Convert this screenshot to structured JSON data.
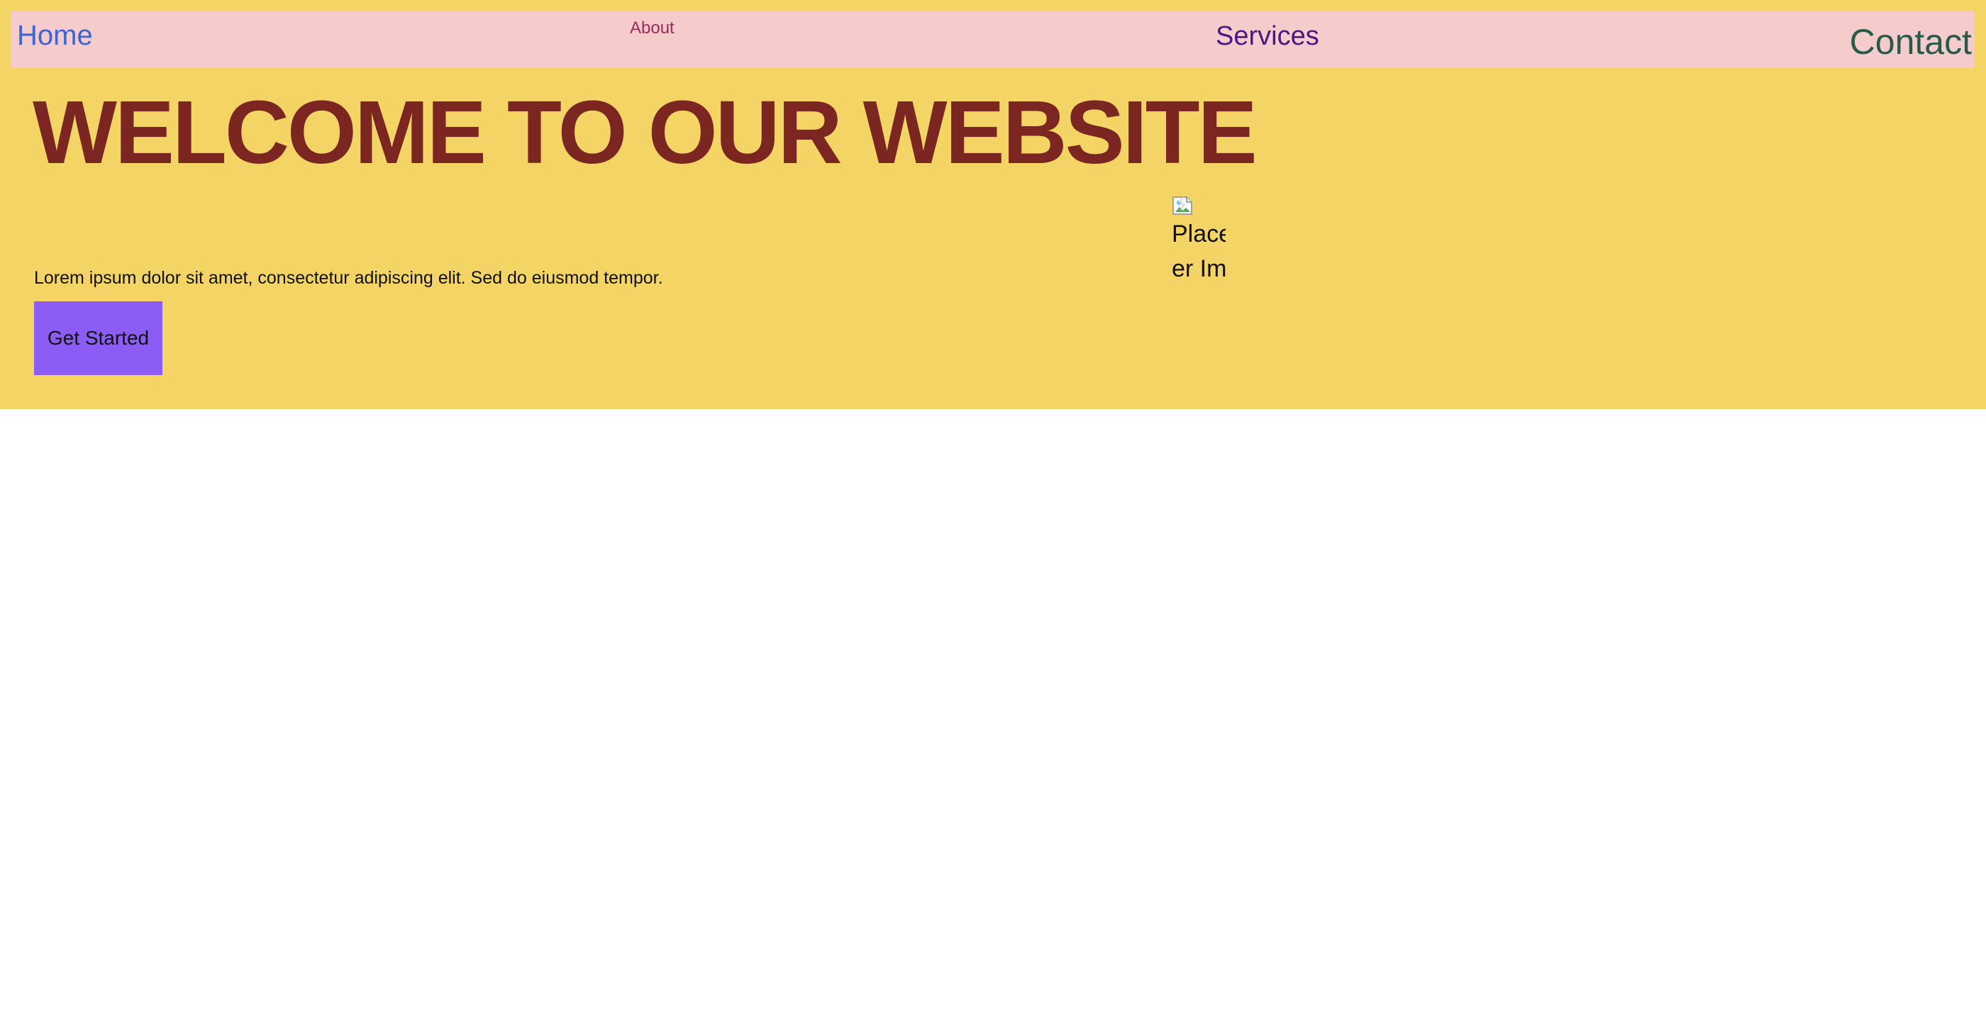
{
  "nav": {
    "items": [
      {
        "label": "Home",
        "color": "#3c64d3"
      },
      {
        "label": "About",
        "color": "#a0295d"
      },
      {
        "label": "Services",
        "color": "#4b1686"
      },
      {
        "label": "Contact",
        "color": "#275a48"
      }
    ]
  },
  "hero": {
    "title": "WELCOME TO OUR WEBSITE",
    "text": "Lorem ipsum dolor sit amet, consectetur adipiscing elit. Sed do eiusmod tempor.",
    "cta_label": "Get Started",
    "image": {
      "alt_text": "Placeholder Image",
      "icon": "broken-image-icon"
    }
  },
  "colors": {
    "hero_background": "#f5d466",
    "nav_background": "#f5cccb",
    "title": "#7b2620",
    "button_background": "#8b5cf6"
  }
}
